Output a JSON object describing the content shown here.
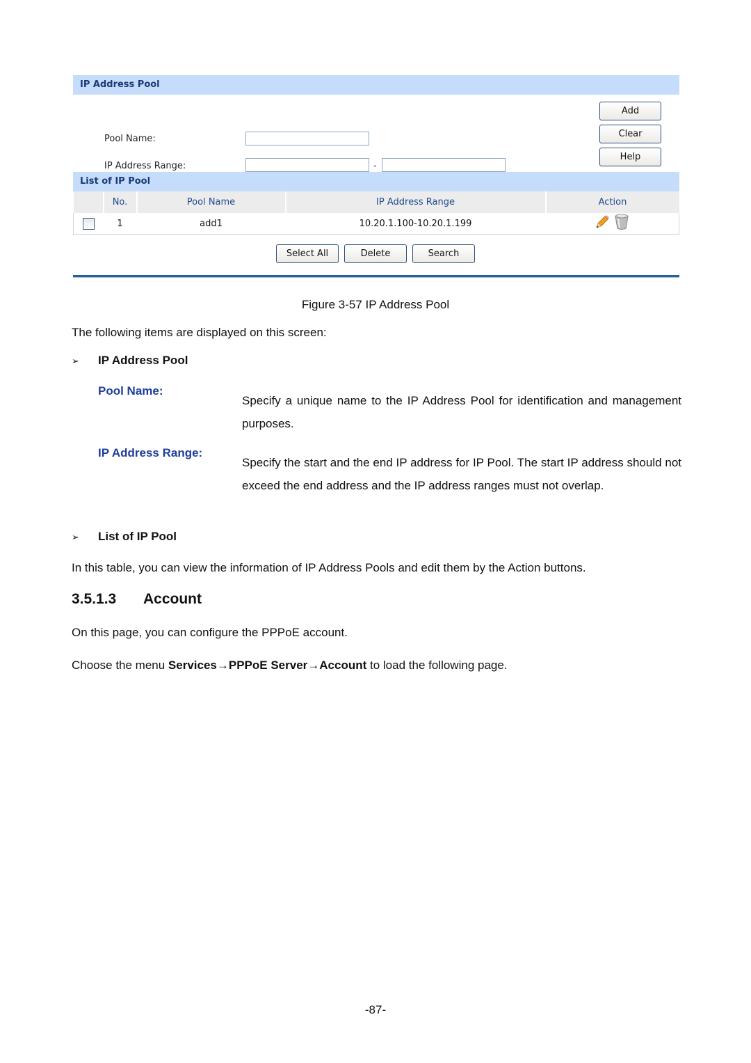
{
  "ui": {
    "ip_pool_panel": {
      "title": "IP Address Pool",
      "pool_name_label": "Pool Name:",
      "pool_name_value": "",
      "ip_range_label": "IP Address Range:",
      "ip_range_start_value": "",
      "ip_range_separator": "-",
      "ip_range_end_value": "",
      "buttons": {
        "add": "Add",
        "clear": "Clear",
        "help": "Help"
      }
    },
    "list_panel": {
      "title": "List of IP Pool",
      "columns": [
        "",
        "No.",
        "Pool Name",
        "IP Address Range",
        "Action"
      ],
      "rows": [
        {
          "checked": false,
          "no": "1",
          "pool_name": "add1",
          "ip_range": "10.20.1.100-10.20.1.199",
          "actions": [
            "edit-pencil-icon",
            "delete-trash-icon"
          ]
        }
      ],
      "buttons": {
        "select_all": "Select All",
        "delete": "Delete",
        "search": "Search"
      }
    }
  },
  "doc": {
    "figure_caption": "Figure 3-57 IP Address Pool",
    "intro": "The following items are displayed on this screen:",
    "bullet_marker": "➢",
    "sections": [
      {
        "heading": "IP Address Pool",
        "items": [
          {
            "term": "Pool Name:",
            "description": "Specify a unique name to the IP Address Pool for identification and management purposes."
          },
          {
            "term": "IP Address Range:",
            "description": "Specify the start and the end IP address for IP Pool. The start IP address should not exceed the end address and the IP address ranges must not overlap."
          }
        ]
      },
      {
        "heading": "List of IP Pool",
        "text": "In this table, you can view the information of IP Address Pools and edit them by the Action buttons."
      }
    ],
    "subsection": {
      "number": "3.5.1.3",
      "title": "Account"
    },
    "account_intro": "On this page, you can configure the PPPoE account.",
    "menu_path": {
      "prefix": "Choose the menu ",
      "path": "Services→PPPoE Server→Account",
      "suffix": " to load the following page."
    },
    "page_number": "-87-"
  },
  "colors": {
    "panel_header_bg": "#c6dcfb",
    "panel_header_text": "#1a3b78",
    "column_header_text": "#1f4b8c",
    "term_color": "#1f3f99",
    "rule_color": "#2d5d9f"
  }
}
